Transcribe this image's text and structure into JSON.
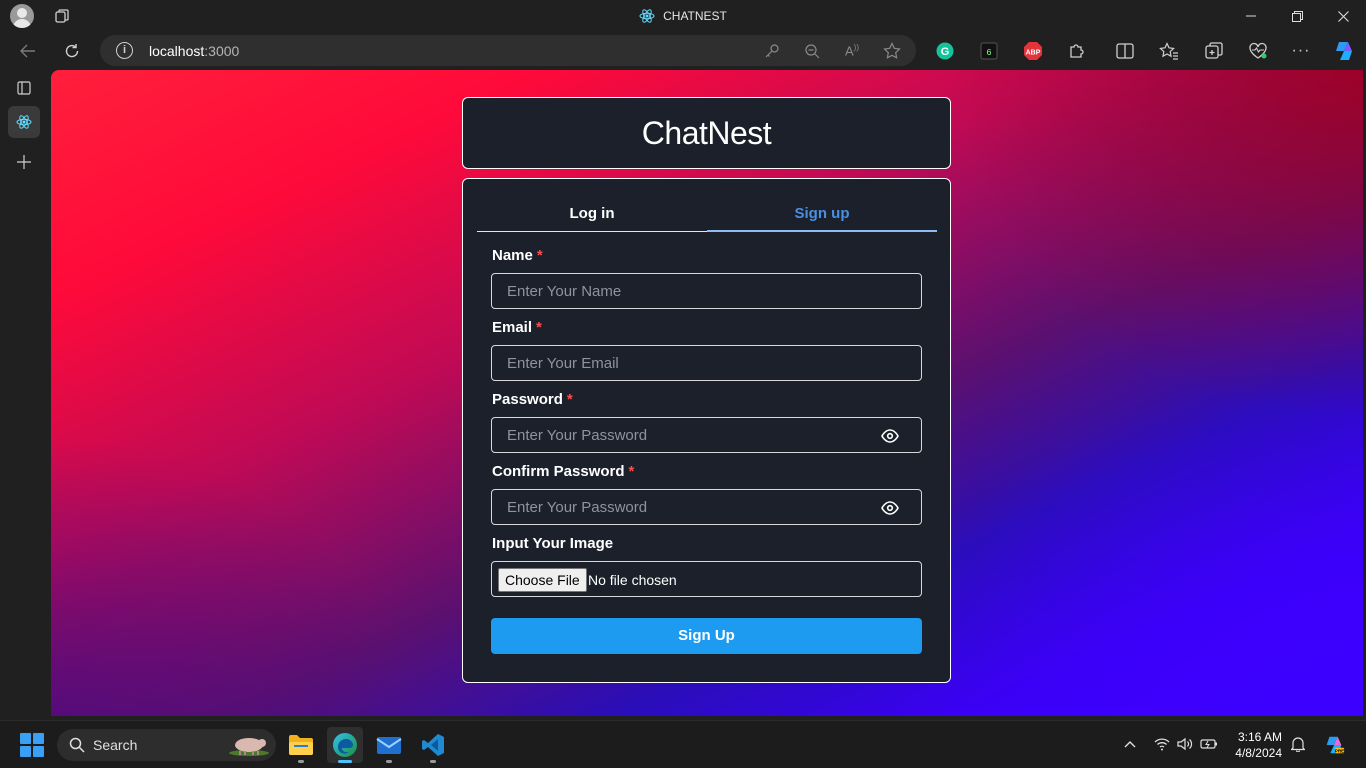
{
  "browser": {
    "tab_title": "CHATNEST",
    "url_host": "localhost",
    "url_port": ":3000",
    "window_controls": [
      "minimize",
      "restore",
      "close"
    ]
  },
  "page": {
    "brand": "ChatNest",
    "tabs": [
      {
        "label": "Log in",
        "active": false
      },
      {
        "label": "Sign up",
        "active": true
      }
    ],
    "fields": {
      "name": {
        "label": "Name",
        "required_mark": "*",
        "placeholder": "Enter Your Name",
        "value": ""
      },
      "email": {
        "label": "Email",
        "required_mark": "*",
        "placeholder": "Enter Your Email",
        "value": ""
      },
      "password": {
        "label": "Password",
        "required_mark": "*",
        "placeholder": "Enter Your Password",
        "value": ""
      },
      "confirm_password": {
        "label": "Confirm Password",
        "required_mark": "*",
        "placeholder": "Enter Your Password",
        "value": ""
      },
      "image": {
        "label": "Input Your Image",
        "button": "Choose File",
        "status": "No file chosen"
      }
    },
    "submit_label": "Sign Up",
    "colors": {
      "accent": "#1d9bf0",
      "card_bg": "#1b202b",
      "active_tab": "#4a8fe0",
      "required": "#ff4d4d"
    }
  },
  "taskbar": {
    "search_label": "Search",
    "time": "3:16 AM",
    "date": "4/8/2024",
    "apps": [
      "file-explorer",
      "edge",
      "mail",
      "vscode"
    ]
  }
}
